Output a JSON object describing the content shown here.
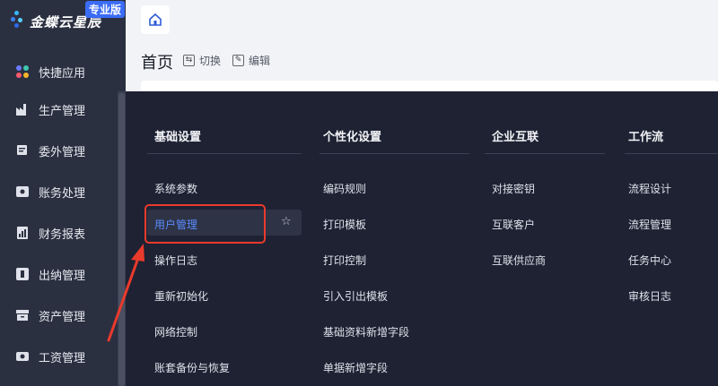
{
  "app": {
    "logo_text": "金蝶云星辰",
    "edition_badge": "专业版"
  },
  "sidebar": {
    "items": [
      {
        "label": "快捷应用",
        "icon": "apps-grid-icon"
      },
      {
        "label": "生产管理",
        "icon": "factory-icon"
      },
      {
        "label": "委外管理",
        "icon": "outsource-icon"
      },
      {
        "label": "账务处理",
        "icon": "ledger-icon"
      },
      {
        "label": "财务报表",
        "icon": "report-icon"
      },
      {
        "label": "出纳管理",
        "icon": "cashier-icon"
      },
      {
        "label": "资产管理",
        "icon": "asset-box-icon"
      },
      {
        "label": "工资管理",
        "icon": "salary-icon"
      }
    ]
  },
  "header": {
    "home_icon": "home-icon",
    "title": "首页",
    "switch_label": "切换",
    "edit_label": "编辑"
  },
  "menu": {
    "columns": [
      {
        "heading": "基础设置",
        "items": [
          "系统参数",
          "用户管理",
          "操作日志",
          "重新初始化",
          "网络控制",
          "账套备份与恢复"
        ]
      },
      {
        "heading": "个性化设置",
        "items": [
          "编码规则",
          "打印模板",
          "打印控制",
          "引入引出模板",
          "基础资料新增字段",
          "单据新增字段"
        ]
      },
      {
        "heading": "企业互联",
        "items": [
          "对接密钥",
          "互联客户",
          "互联供应商"
        ]
      },
      {
        "heading": "工作流",
        "items": [
          "流程设计",
          "流程管理",
          "任务中心",
          "审核日志"
        ]
      }
    ],
    "active_item": "用户管理",
    "favorite_icon": "star-outline-icon"
  },
  "colors": {
    "sidebar_bg": "#2b3041",
    "panel_bg": "#1e2233",
    "active_text": "#5b8dff",
    "annotation_red": "#ea3a2c"
  }
}
